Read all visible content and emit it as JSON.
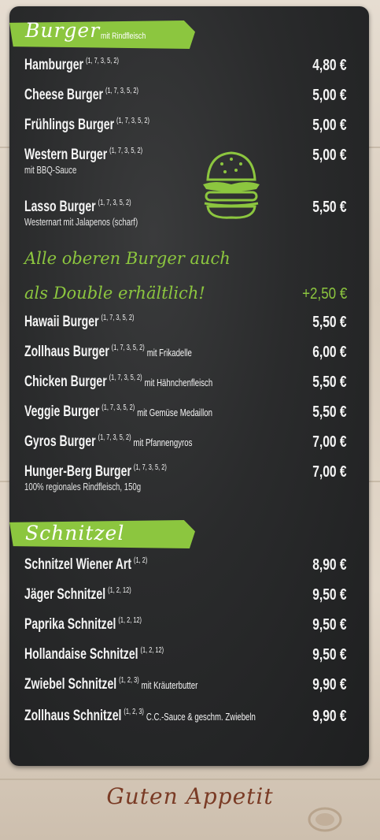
{
  "burger_section": {
    "title": "Burger",
    "subtitle": "mit Rindfleisch",
    "items": [
      {
        "name": "Hamburger",
        "allergens": "(1, 7, 3, 5, 2)",
        "extra": "",
        "description": "",
        "price": "4,80 €"
      },
      {
        "name": "Cheese Burger",
        "allergens": "(1, 7, 3, 5, 2)",
        "extra": "",
        "description": "",
        "price": "5,00 €"
      },
      {
        "name": "Frühlings Burger",
        "allergens": "(1, 7, 3, 5, 2)",
        "extra": "",
        "description": "",
        "price": "5,00 €"
      },
      {
        "name": "Western Burger",
        "allergens": "(1, 7, 3, 5, 2)",
        "extra": "",
        "description": "mit BBQ-Sauce",
        "price": "5,00 €"
      },
      {
        "name": "Lasso Burger",
        "allergens": "(1, 7, 3, 5, 2)",
        "extra": "",
        "description": "Westernart mit Jalapenos (scharf)",
        "price": "5,50 €"
      }
    ],
    "promo_line1": "Alle oberen Burger auch",
    "promo_line2": "als Double erhältlich!",
    "promo_price": "+2,50 €",
    "items2": [
      {
        "name": "Hawaii Burger",
        "allergens": "(1, 7, 3, 5, 2)",
        "extra": "",
        "description": "",
        "price": "5,50 €"
      },
      {
        "name": "Zollhaus Burger",
        "allergens": "(1, 7, 3, 5, 2)",
        "extra": "mit Frikadelle",
        "description": "",
        "price": "6,00 €"
      },
      {
        "name": "Chicken Burger",
        "allergens": "(1, 7, 3, 5, 2)",
        "extra": "mit Hähnchenfleisch",
        "description": "",
        "price": "5,50 €"
      },
      {
        "name": "Veggie Burger",
        "allergens": "(1, 7, 3, 5, 2)",
        "extra": "mit Gemüse Medaillon",
        "description": "",
        "price": "5,50 €"
      },
      {
        "name": "Gyros Burger",
        "allergens": "(1, 7, 3, 5, 2)",
        "extra": "mit Pfannengyros",
        "description": "",
        "price": "7,00 €"
      },
      {
        "name": "Hunger-Berg Burger",
        "allergens": "(1, 7, 3, 5, 2)",
        "extra": "",
        "description": "100% regionales Rindfleisch, 150g",
        "price": "7,00 €"
      }
    ]
  },
  "schnitzel_section": {
    "title": "Schnitzel",
    "items": [
      {
        "name": "Schnitzel Wiener Art",
        "allergens": "(1, 2)",
        "extra": "",
        "price": "8,90 €"
      },
      {
        "name": "Jäger Schnitzel",
        "allergens": "(1, 2, 12)",
        "extra": "",
        "price": "9,50 €"
      },
      {
        "name": "Paprika Schnitzel",
        "allergens": "(1, 2, 12)",
        "extra": "",
        "price": "9,50 €"
      },
      {
        "name": "Hollandaise Schnitzel",
        "allergens": "(1, 2, 12)",
        "extra": "",
        "price": "9,50 €"
      },
      {
        "name": "Zwiebel Schnitzel",
        "allergens": "(1, 2, 3)",
        "extra": "mit Kräuterbutter",
        "price": "9,90 €"
      },
      {
        "name": "Zollhaus Schnitzel",
        "allergens": "(1, 2, 3)",
        "extra": "C.C.-Sauce & geschm. Zwiebeln",
        "price": "9,90 €"
      }
    ]
  },
  "footer": "Guten Appetit",
  "colors": {
    "accent": "#8cc63f",
    "board": "#2a2b2c",
    "footer_text": "#7a3b25"
  },
  "icons": [
    "burger-icon",
    "coffee-cup-icon"
  ]
}
